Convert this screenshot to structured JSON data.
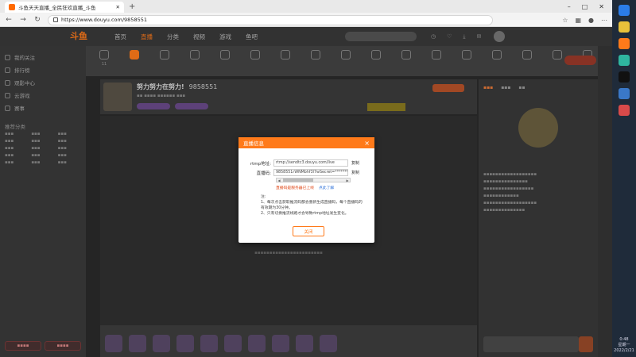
{
  "browser": {
    "tab_title": "斗鱼天天直播_全民狂欢直播_斗鱼",
    "url": "https://www.douyu.com/9858551"
  },
  "site": {
    "logo": "斗鱼",
    "nav": [
      "首页",
      "直播",
      "分类",
      "视频",
      "游戏",
      "鱼吧"
    ]
  },
  "sidebar": {
    "items": [
      "我的关注",
      "排行榜",
      "观影中心",
      "云游戏",
      "赛事"
    ],
    "section_label": "推荐分类"
  },
  "category": {
    "badge_num": "11"
  },
  "room": {
    "title": "努力努力在努力!",
    "id": "9858551"
  },
  "modal": {
    "title": "直播信息",
    "close": "×",
    "rtmp_label": "rtmp地址:",
    "rtmp_value": "rtmp://sendtc3.douyu.com/live",
    "code_label": "直播码:",
    "code_value": "9858551rWNMbhf3l7wSecret=**********",
    "copy_label": "复制",
    "warn_text": "直播码是服务器已上线",
    "warn_link": "点此了解",
    "notes_title": "注:",
    "note1": "1、每次点击获取推流码都会重新生成直播码，每个直播码的有效期为30分钟。",
    "note2": "2、只有切换推流线路才会导致rtmp地址发生变化。",
    "close_button": "关闭"
  },
  "taskbar": {
    "time": "0:48",
    "weekday": "星期一",
    "date": "2022/2/21"
  },
  "colors": {
    "accent": "#ff7a1a",
    "warn": "#e04a1a",
    "link": "#2a6ed8"
  }
}
